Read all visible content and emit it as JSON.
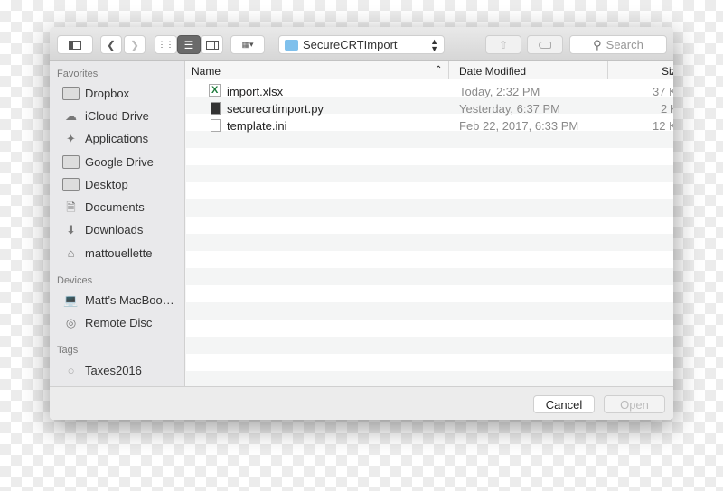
{
  "toolbar": {
    "location": "SecureCRTImport",
    "search_placeholder": "Search"
  },
  "sidebar": {
    "favorites_label": "Favorites",
    "favorites": [
      {
        "label": "Dropbox",
        "icon": "folder-icon"
      },
      {
        "label": "iCloud Drive",
        "icon": "cloud-icon"
      },
      {
        "label": "Applications",
        "icon": "applications-icon"
      },
      {
        "label": "Google Drive",
        "icon": "folder-icon"
      },
      {
        "label": "Desktop",
        "icon": "desktop-folder-icon"
      },
      {
        "label": "Documents",
        "icon": "documents-icon"
      },
      {
        "label": "Downloads",
        "icon": "downloads-icon"
      },
      {
        "label": "mattouellette",
        "icon": "home-icon"
      }
    ],
    "devices_label": "Devices",
    "devices": [
      {
        "label": "Matt’s MacBoo…",
        "icon": "laptop-icon"
      },
      {
        "label": "Remote Disc",
        "icon": "disc-icon"
      }
    ],
    "tags_label": "Tags",
    "tags": [
      {
        "label": "Taxes2016",
        "icon": "tag-circle-icon"
      }
    ]
  },
  "columns": {
    "name": "Name",
    "date": "Date Modified",
    "size": "Siz"
  },
  "files": [
    {
      "name": "import.xlsx",
      "date": "Today, 2:32 PM",
      "size": "37 K"
    },
    {
      "name": "securecrtimport.py",
      "date": "Yesterday, 6:37 PM",
      "size": "2 K"
    },
    {
      "name": "template.ini",
      "date": "Feb 22, 2017, 6:33 PM",
      "size": "12 K"
    }
  ],
  "buttons": {
    "cancel": "Cancel",
    "open": "Open"
  }
}
